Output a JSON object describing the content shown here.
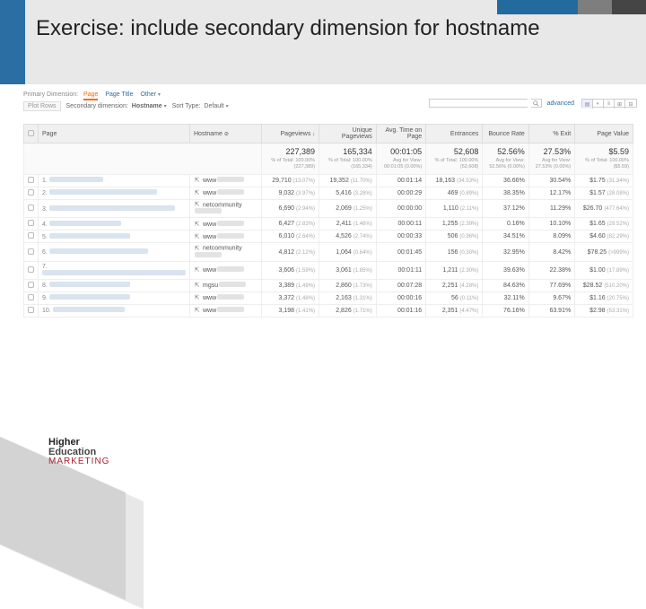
{
  "slide": {
    "title": "Exercise: include secondary dimension for hostname"
  },
  "crumb": {
    "p1": "Primary Dimension:",
    "p2": "Page",
    "p3": "Page Title",
    "p4": "Other"
  },
  "controls": {
    "plot_label": "Plot Rows",
    "sec_label": "Secondary dimension:",
    "sec_value": "Hostname",
    "sort_label": "Sort Type:",
    "sort_value": "Default",
    "advanced": "advanced"
  },
  "cols": {
    "c0": "",
    "c1": "Page",
    "c2": "Hostname",
    "c3": "Pageviews",
    "c4": "Unique Pageviews",
    "c5": "Avg. Time on Page",
    "c6": "Entrances",
    "c7": "Bounce Rate",
    "c8": "% Exit",
    "c9": "Page Value"
  },
  "summary": {
    "pv": {
      "v": "227,389",
      "s": "% of Total: 100.00% (227,389)"
    },
    "upv": {
      "v": "165,334",
      "s": "% of Total: 100.00% (165,334)"
    },
    "time": {
      "v": "00:01:05",
      "s": "Avg for View: 00:01:05 (0.00%)"
    },
    "ent": {
      "v": "52,608",
      "s": "% of Total: 100.00% (52,608)"
    },
    "br": {
      "v": "52.56%",
      "s": "Avg for View: 52.56% (0.00%)"
    },
    "exit": {
      "v": "27.53%",
      "s": "Avg for View: 27.53% (0.00%)"
    },
    "val": {
      "v": "$5.59",
      "s": "% of Total: 100.00% ($5.59)"
    }
  },
  "rows": [
    {
      "n": "1.",
      "host": "www",
      "pv": "29,710",
      "pvp": "(13.07%)",
      "upv": "19,352",
      "upvp": "(11.70%)",
      "t": "00:01:14",
      "ent": "18,163",
      "entp": "(34.53%)",
      "br": "36.66%",
      "ex": "30.54%",
      "val": "$1.75",
      "valp": "(31.34%)"
    },
    {
      "n": "2.",
      "host": "www",
      "pv": "9,032",
      "pvp": "(3.97%)",
      "upv": "5,416",
      "upvp": "(3.28%)",
      "t": "00:00:29",
      "ent": "469",
      "entp": "(0.89%)",
      "br": "38.35%",
      "ex": "12.17%",
      "val": "$1.57",
      "valp": "(28.08%)"
    },
    {
      "n": "3.",
      "host": "netcommunity",
      "pv": "6,690",
      "pvp": "(2.94%)",
      "upv": "2,069",
      "upvp": "(1.25%)",
      "t": "00:00:00",
      "ent": "1,110",
      "entp": "(2.11%)",
      "br": "37.12%",
      "ex": "11.29%",
      "val": "$26.70",
      "valp": "(477.64%)"
    },
    {
      "n": "4.",
      "host": "www",
      "pv": "6,427",
      "pvp": "(2.83%)",
      "upv": "2,411",
      "upvp": "(1.46%)",
      "t": "00:00:11",
      "ent": "1,255",
      "entp": "(2.39%)",
      "br": "0.16%",
      "ex": "10.10%",
      "val": "$1.65",
      "valp": "(29.52%)"
    },
    {
      "n": "5.",
      "host": "www",
      "pv": "6,010",
      "pvp": "(2.64%)",
      "upv": "4,526",
      "upvp": "(2.74%)",
      "t": "00:00:33",
      "ent": "506",
      "entp": "(0.96%)",
      "br": "34.51%",
      "ex": "8.09%",
      "val": "$4.60",
      "valp": "(82.29%)"
    },
    {
      "n": "6.",
      "host": "netcommunity",
      "pv": "4,812",
      "pvp": "(2.12%)",
      "upv": "1,064",
      "upvp": "(0.64%)",
      "t": "00:01:45",
      "ent": "156",
      "entp": "(0.30%)",
      "br": "32.95%",
      "ex": "8.42%",
      "val": "$78.25",
      "valp": "(>999%)"
    },
    {
      "n": "7.",
      "host": "www",
      "pv": "3,606",
      "pvp": "(1.59%)",
      "upv": "3,061",
      "upvp": "(1.85%)",
      "t": "00:01:11",
      "ent": "1,211",
      "entp": "(2.30%)",
      "br": "39.63%",
      "ex": "22.38%",
      "val": "$1.00",
      "valp": "(17.89%)"
    },
    {
      "n": "8.",
      "host": "mgsu",
      "pv": "3,389",
      "pvp": "(1.49%)",
      "upv": "2,860",
      "upvp": "(1.73%)",
      "t": "00:07:28",
      "ent": "2,251",
      "entp": "(4.28%)",
      "br": "84.63%",
      "ex": "77.69%",
      "val": "$28.52",
      "valp": "(510.20%)"
    },
    {
      "n": "9.",
      "host": "www",
      "pv": "3,372",
      "pvp": "(1.48%)",
      "upv": "2,163",
      "upvp": "(1.31%)",
      "t": "00:00:16",
      "ent": "56",
      "entp": "(0.11%)",
      "br": "32.11%",
      "ex": "9.67%",
      "val": "$1.16",
      "valp": "(20.75%)"
    },
    {
      "n": "10.",
      "host": "www",
      "pv": "3,198",
      "pvp": "(1.41%)",
      "upv": "2,826",
      "upvp": "(1.71%)",
      "t": "00:01:16",
      "ent": "2,351",
      "entp": "(4.47%)",
      "br": "76.16%",
      "ex": "63.91%",
      "val": "$2.98",
      "valp": "(53.31%)"
    }
  ],
  "logo": {
    "l1": "Higher",
    "l2": "Education",
    "l3": "MARKETING"
  }
}
